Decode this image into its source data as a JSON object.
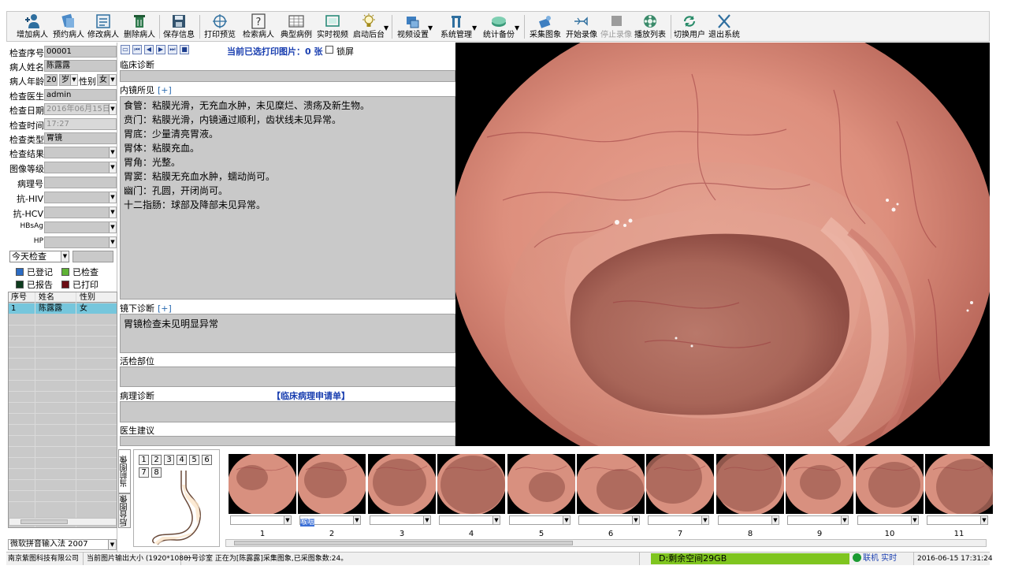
{
  "toolbar": {
    "buttons": [
      {
        "label": "增加病人",
        "icon": "add-patient-icon"
      },
      {
        "label": "预约病人",
        "icon": "appointment-icon"
      },
      {
        "label": "修改病人",
        "icon": "edit-patient-icon"
      },
      {
        "label": "删除病人",
        "icon": "delete-patient-icon"
      },
      {
        "label": "保存信息",
        "icon": "save-icon"
      },
      {
        "label": "打印预览",
        "icon": "print-preview-icon"
      },
      {
        "label": "检索病人",
        "icon": "search-patient-icon"
      },
      {
        "label": "典型病例",
        "icon": "typical-case-icon"
      },
      {
        "label": "实时视频",
        "icon": "live-video-icon"
      },
      {
        "label": "启动后台",
        "icon": "start-backend-icon"
      },
      {
        "label": "视频设置",
        "icon": "video-settings-icon"
      },
      {
        "label": "系统管理",
        "icon": "system-admin-icon"
      },
      {
        "label": "统计备份",
        "icon": "stats-backup-icon"
      },
      {
        "label": "采集图象",
        "icon": "capture-image-icon"
      },
      {
        "label": "开始录像",
        "icon": "start-record-icon"
      },
      {
        "label": "停止录像",
        "icon": "stop-record-icon"
      },
      {
        "label": "播放列表",
        "icon": "playlist-icon"
      },
      {
        "label": "切换用户",
        "icon": "switch-user-icon"
      },
      {
        "label": "退出系统",
        "icon": "exit-icon"
      }
    ]
  },
  "form": {
    "exam_no": {
      "label": "检查序号",
      "value": "00001"
    },
    "patient_name": {
      "label": "病人姓名",
      "value": "陈露露"
    },
    "patient_age": {
      "label": "病人年龄",
      "value": "20",
      "unit": "岁"
    },
    "gender": {
      "label": "性别",
      "value": "女"
    },
    "doctor": {
      "label": "检查医生",
      "value": "admin"
    },
    "exam_date": {
      "label": "检查日期",
      "value": "2016年06月15日"
    },
    "exam_time": {
      "label": "检查时间",
      "value": "17:27"
    },
    "exam_type": {
      "label": "检查类型",
      "value": "胃镜"
    },
    "exam_result": {
      "label": "检查结果",
      "value": ""
    },
    "image_grade": {
      "label": "图像等级",
      "value": ""
    },
    "pathology_no": {
      "label": "病理号",
      "value": ""
    },
    "hiv": {
      "label": "抗-HIV",
      "value": ""
    },
    "hcv": {
      "label": "抗-HCV",
      "value": ""
    },
    "hbsag": {
      "label": "HBsAg",
      "value": ""
    },
    "hp": {
      "label": "HP",
      "value": ""
    }
  },
  "filter": {
    "value": "今天检查",
    "extra": ""
  },
  "legend": [
    {
      "label": "已登记",
      "color": "#2b6cc4"
    },
    {
      "label": "已检查",
      "color": "#5fb335"
    },
    {
      "label": "已报告",
      "color": "#0d3b1e"
    },
    {
      "label": "已打印",
      "color": "#6b0d14"
    }
  ],
  "patient_table": {
    "headers": [
      "序号",
      "姓名",
      "性别"
    ],
    "rows": [
      [
        "1",
        "陈露露",
        "女"
      ]
    ]
  },
  "ime": {
    "value": "微软拼音输入法 2007"
  },
  "mid": {
    "print_selected": "当前已选打印图片：0 张",
    "lock_label": "锁屏",
    "clinical_dx_title": "临床诊断",
    "endo_findings_title": "内镜所见",
    "plus": "[+]",
    "findings": [
      "食管：粘膜光滑，无充血水肿，未见糜烂、溃疡及新生物。",
      "贲门：粘膜光滑，内镜通过顺利，齿状线未见异常。",
      "胃底：少量清亮胃液。",
      "胃体：粘膜充血。",
      "胃角：光整。",
      "胃窦：粘膜无充血水肿，蠕动尚可。",
      "幽门：孔圆，开闭尚可。",
      "十二指肠：球部及降部未见异常。"
    ],
    "endo_dx_title": "镜下诊断",
    "endo_dx_text": "胃镜检查未见明显异常",
    "biopsy_title": "活检部位",
    "pathology_title": "病理诊断",
    "pathology_request": "【临床病理申请单】",
    "advice_title": "医生建议"
  },
  "bottom": {
    "tab_current": "当前图像",
    "tab_backend": "后台图像",
    "site_numbers": [
      "1",
      "2",
      "3",
      "4",
      "5",
      "6",
      "7",
      "8"
    ],
    "thumbnails": [
      {
        "num": "1",
        "tag": ""
      },
      {
        "num": "2",
        "tag": "喉咽"
      },
      {
        "num": "3",
        "tag": ""
      },
      {
        "num": "4",
        "tag": ""
      },
      {
        "num": "5",
        "tag": ""
      },
      {
        "num": "6",
        "tag": ""
      },
      {
        "num": "7",
        "tag": ""
      },
      {
        "num": "8",
        "tag": ""
      },
      {
        "num": "9",
        "tag": ""
      },
      {
        "num": "10",
        "tag": ""
      },
      {
        "num": "11",
        "tag": ""
      }
    ]
  },
  "status": {
    "company": "南京紫图科技有限公司",
    "resolution": "当前图片输出大小 (1920*1080)",
    "room_info": "一号诊室 正在为[陈露露]采集图象,已采图象数:24。",
    "disk": "D:剩余空间29GB",
    "online": "联机 实时",
    "datetime": "2016-06-15 17:31:24"
  },
  "colors": {
    "field_bg": "#c9c9c9",
    "selected_row": "#76c6dc",
    "disk_bar": "#7fc51f",
    "accent_blue": "#1a3fb0"
  }
}
